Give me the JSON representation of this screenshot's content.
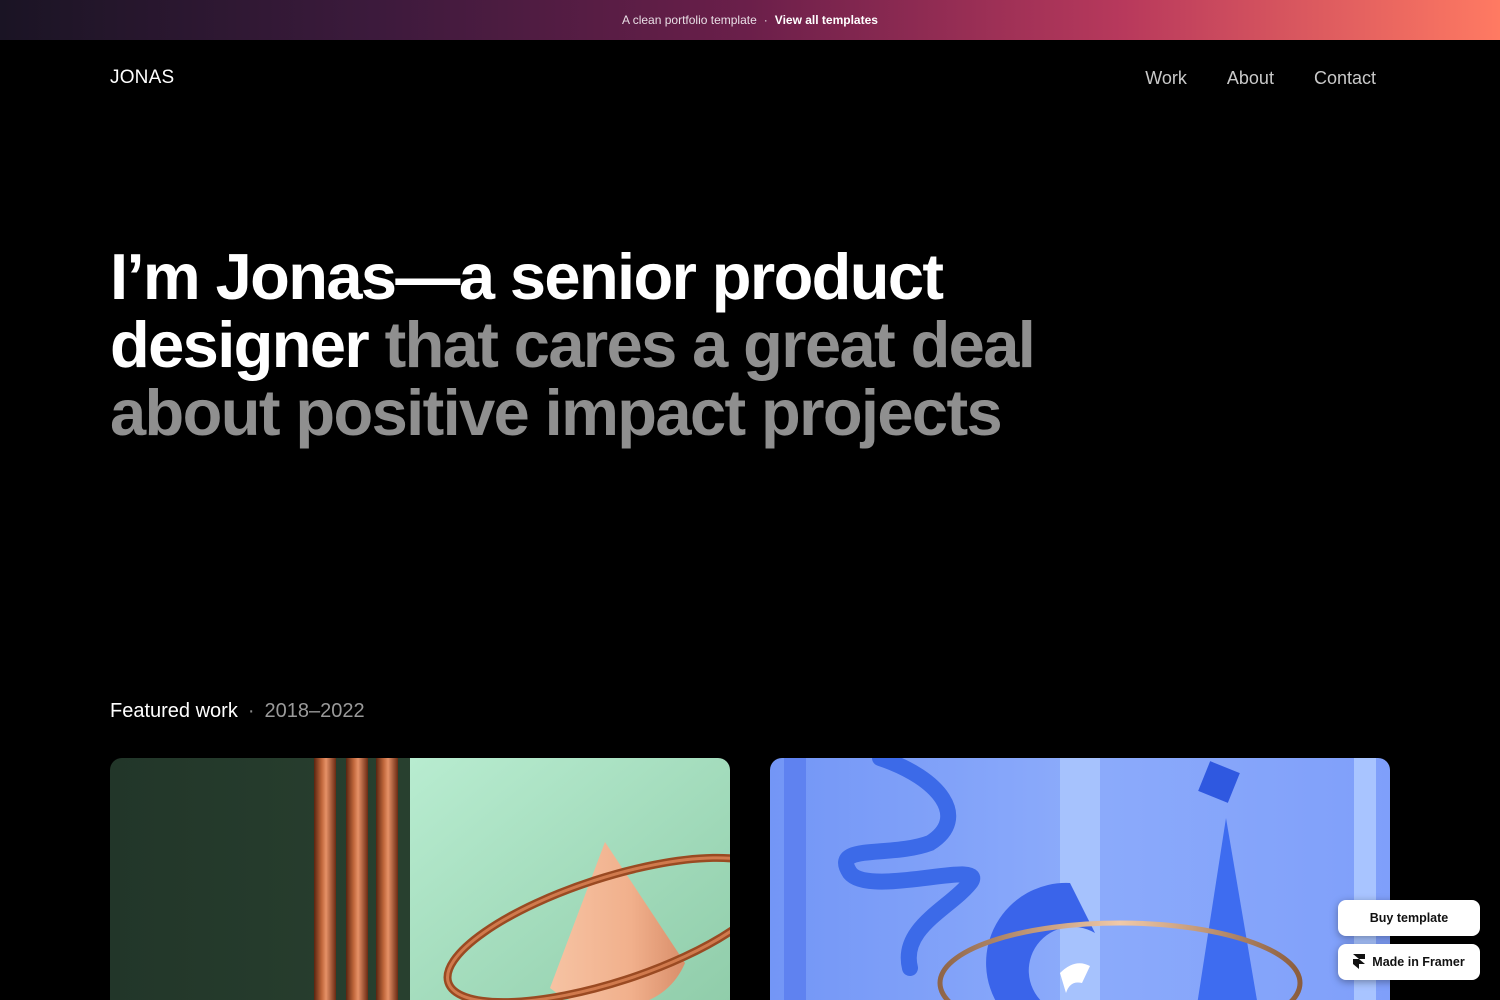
{
  "banner": {
    "text": "A clean portfolio template",
    "separator": "·",
    "link_label": "View all templates"
  },
  "nav": {
    "brand": "JONAS",
    "links": [
      "Work",
      "About",
      "Contact"
    ]
  },
  "hero": {
    "line1": "I’m Jonas—a senior product",
    "line2_emphasis": "designer",
    "line2_rest": "that cares a great deal",
    "line3": "about positive impact projects"
  },
  "featured": {
    "label": "Featured work",
    "separator": "·",
    "years": "2018–2022"
  },
  "floating": {
    "buy_label": "Buy template",
    "framer_label": "Made in Framer"
  },
  "colors": {
    "banner_gradient": [
      "#1a1424",
      "#6b1f4a",
      "#ff7a62"
    ],
    "background": "#000000",
    "hero_muted": "#8f8f8f",
    "card1_dark": "#233a2e",
    "card1_light": "#a9e3c3",
    "card2_blue": "#7f9ffb"
  }
}
